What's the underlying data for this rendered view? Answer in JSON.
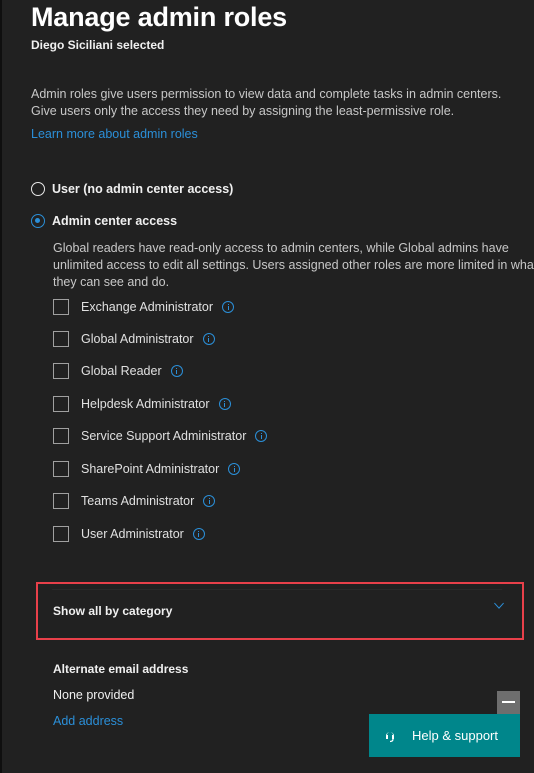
{
  "header": {
    "title": "Manage admin roles",
    "subtitle": "Diego Siciliani selected"
  },
  "description": "Admin roles give users permission to view data and complete tasks in admin centers. Give users only the access they need by assigning the least-permissive role.",
  "learn_more_link": "Learn more about admin roles",
  "access_options": [
    {
      "label": "User (no admin center access)",
      "selected": false
    },
    {
      "label": "Admin center access",
      "selected": true
    }
  ],
  "admin_description": "Global readers have read-only access to admin centers, while Global admins have unlimited access to edit all settings. Users assigned other roles are more limited in what they can see and do.",
  "roles": [
    {
      "label": "Exchange Administrator",
      "checked": false
    },
    {
      "label": "Global Administrator",
      "checked": false
    },
    {
      "label": "Global Reader",
      "checked": false
    },
    {
      "label": "Helpdesk Administrator",
      "checked": false
    },
    {
      "label": "Service Support Administrator",
      "checked": false
    },
    {
      "label": "SharePoint Administrator",
      "checked": false
    },
    {
      "label": "Teams Administrator",
      "checked": false
    },
    {
      "label": "User Administrator",
      "checked": false
    }
  ],
  "category_toggle": {
    "label": "Show all by category",
    "icon": "chevron-down-icon",
    "highlight_color": "#e8404a"
  },
  "alternate_email": {
    "title": "Alternate email address",
    "value": "None provided",
    "add_link": "Add address"
  },
  "help_widget": {
    "label": "Help & support",
    "icon": "headset-icon",
    "minimize_icon": "minimize-icon",
    "color": "#00868b"
  },
  "colors": {
    "background": "#212121",
    "accent": "#2b8fd8"
  }
}
